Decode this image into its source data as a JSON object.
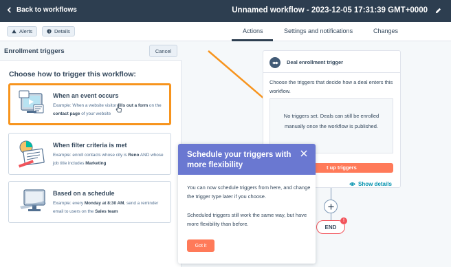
{
  "topbar": {
    "back_label": "Back to workflows",
    "workflow_title": "Unnamed workflow - 2023-12-05 17:31:39 GMT+0000"
  },
  "subbar": {
    "alerts_label": "Alerts",
    "details_label": "Details",
    "tabs": [
      {
        "label": "Actions",
        "active": true
      },
      {
        "label": "Settings and notifications",
        "active": false
      },
      {
        "label": "Changes",
        "active": false
      }
    ]
  },
  "left_panel": {
    "title": "Enrollment triggers",
    "cancel_label": "Cancel",
    "choose_heading": "Choose how to trigger this workflow:",
    "cards": [
      {
        "title": "When an event occurs",
        "desc_parts": [
          "Example: When a website visitor ",
          "fills out a form",
          " on the ",
          "contact page",
          " of your website"
        ],
        "selected": true
      },
      {
        "title": "When filter criteria is met",
        "desc_parts": [
          "Example: enroll contacts whose city is ",
          "Reno",
          " AND whose job title includes ",
          "Marketing"
        ],
        "selected": false
      },
      {
        "title": "Based on a schedule",
        "desc_parts": [
          "Example: every ",
          "Monday at 8:30 AM",
          ", send a reminder email to users on the ",
          "Sales team"
        ],
        "selected": false
      }
    ]
  },
  "canvas": {
    "trigger_panel": {
      "title": "Deal enrollment trigger",
      "description": "Choose the triggers that decide how a deal enters this workflow.",
      "empty_text": "No triggers set. Deals can still be enrolled manually once the workflow is published.",
      "button_label": "t up triggers"
    },
    "show_details_label": "Show details",
    "end_label": "END",
    "end_badge": "!"
  },
  "popover": {
    "title": "Schedule your triggers with more flexibility",
    "p1": "You can now schedule triggers from here, and change the trigger type later if you choose.",
    "p2": "Scheduled triggers still work the same way, but have more flexibility than before.",
    "button_label": "Got it"
  },
  "colors": {
    "topbar_bg": "#2d3e50",
    "highlight_orange": "#f7941d",
    "popover_header": "#6a78d1",
    "cta_orange": "#ff7a59",
    "link_teal": "#0091ae",
    "end_red": "#f2545b"
  },
  "icons": [
    "chevron-left-icon",
    "pencil-icon",
    "warning-icon",
    "info-icon",
    "handshake-icon",
    "eye-icon",
    "plus-icon",
    "close-icon",
    "pointer-cursor-icon"
  ]
}
